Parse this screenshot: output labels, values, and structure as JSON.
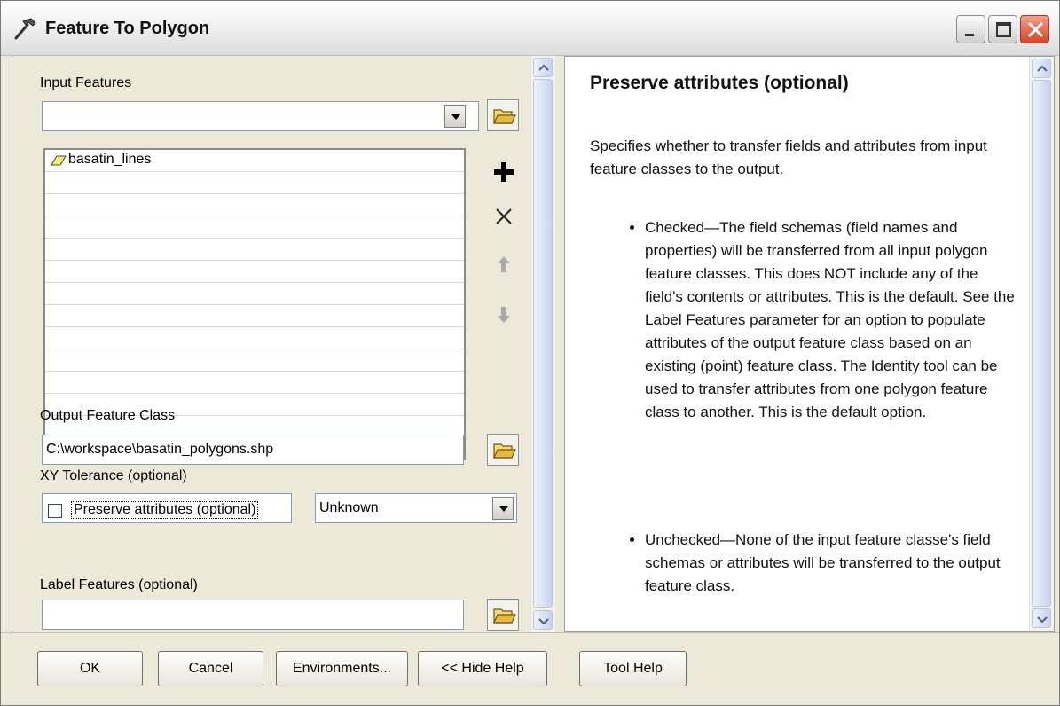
{
  "window": {
    "title": "Feature To Polygon",
    "icon": "hammer-icon"
  },
  "form": {
    "input_features": {
      "label": "Input Features",
      "value": "",
      "items": [
        "basatin_lines"
      ]
    },
    "output_feature_class": {
      "label": "Output Feature Class",
      "value": "C:\\workspace\\basatin_polygons.shp"
    },
    "xy_tolerance": {
      "label": "XY Tolerance (optional)",
      "value": "",
      "unit": "Unknown"
    },
    "preserve_attributes": {
      "label": "Preserve attributes (optional)",
      "checked": false
    },
    "label_features": {
      "label": "Label Features (optional)",
      "value": ""
    }
  },
  "help": {
    "title": "Preserve attributes (optional)",
    "intro": "Specifies whether to transfer fields and attributes from input feature classes to the output.",
    "bullets": [
      "Checked—The field schemas (field names and properties) will be transferred from all input polygon feature classes. This does NOT include any of the field's contents or attributes. This is the default. See the Label Features parameter for an option to populate attributes of the output feature class based on an existing (point) feature class. The Identity tool can be used to transfer attributes from one polygon feature class to another. This is the default option.",
      "Unchecked—None of the input feature classe's field schemas or attributes will be transferred to the output feature class."
    ]
  },
  "buttons": {
    "ok": "OK",
    "cancel": "Cancel",
    "environments": "Environments...",
    "hide_help": "<< Hide Help",
    "tool_help": "Tool Help"
  }
}
